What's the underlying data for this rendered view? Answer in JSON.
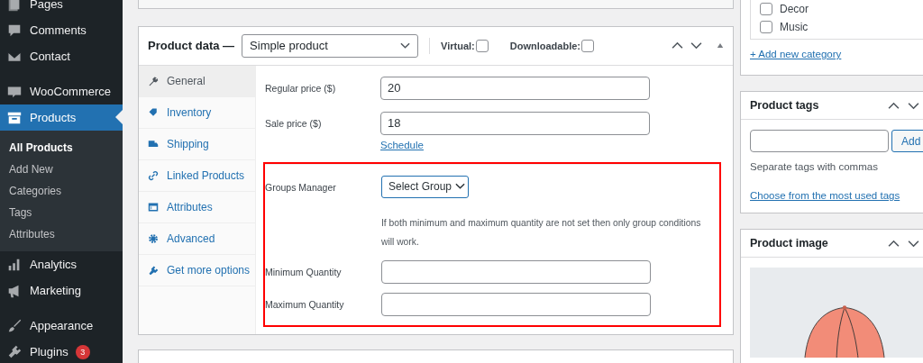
{
  "sidebar": {
    "groups": [
      [
        {
          "label": "Pages",
          "selected": false
        },
        {
          "label": "Comments",
          "selected": false
        },
        {
          "label": "Contact",
          "selected": false
        }
      ],
      [
        {
          "label": "WooCommerce",
          "selected": false
        },
        {
          "label": "Products",
          "selected": true,
          "children": [
            {
              "label": "All Products",
              "selected": true
            },
            {
              "label": "Add New",
              "selected": false
            },
            {
              "label": "Categories",
              "selected": false
            },
            {
              "label": "Tags",
              "selected": false
            },
            {
              "label": "Attributes",
              "selected": false
            }
          ]
        }
      ],
      [
        {
          "label": "Analytics",
          "selected": false
        },
        {
          "label": "Marketing",
          "selected": false
        }
      ],
      [
        {
          "label": "Appearance",
          "selected": false
        },
        {
          "label": "Plugins",
          "selected": false,
          "badge": "3"
        }
      ]
    ]
  },
  "product_data": {
    "title": "Product data —",
    "type": "Simple product",
    "checkboxes": [
      {
        "label": "Virtual:",
        "checked": false
      },
      {
        "label": "Downloadable:",
        "checked": false
      }
    ],
    "tabs": [
      {
        "label": "General",
        "selected": true
      },
      {
        "label": "Inventory",
        "selected": false
      },
      {
        "label": "Shipping",
        "selected": false
      },
      {
        "label": "Linked Products",
        "selected": false
      },
      {
        "label": "Attributes",
        "selected": false
      },
      {
        "label": "Advanced",
        "selected": false
      },
      {
        "label": "Get more options",
        "selected": false
      }
    ],
    "fields": [
      {
        "kind": "input",
        "label": "Regular price ($)",
        "value": "20"
      },
      {
        "kind": "input",
        "label": "Sale price ($)",
        "value": "18",
        "link": "Schedule"
      }
    ],
    "groups_section": [
      {
        "kind": "select",
        "label": "Groups Manager",
        "value": "Select Group",
        "help": "If both minimum and maximum quantity are not set then only group conditions will work."
      },
      {
        "kind": "input",
        "label": "Minimum Quantity"
      },
      {
        "kind": "input",
        "label": "Maximum Quantity"
      }
    ]
  },
  "categories": {
    "items": [
      {
        "label": "Decor",
        "checked": false
      },
      {
        "label": "Music",
        "checked": false
      }
    ],
    "add_link": "+ Add new category"
  },
  "product_tags": {
    "title": "Product tags",
    "button": "Add",
    "hint": "Separate tags with commas",
    "link": "Choose from the most used tags"
  },
  "product_image": {
    "title": "Product image"
  }
}
